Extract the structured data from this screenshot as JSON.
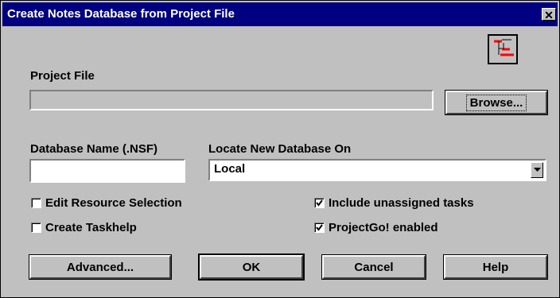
{
  "window": {
    "title": "Create Notes Database from Project File",
    "close_glyph": "✕"
  },
  "project_file": {
    "label": "Project File",
    "value": "",
    "browse_label": "Browse..."
  },
  "database_name": {
    "label": "Database Name (.NSF)",
    "value": ""
  },
  "locate": {
    "label": "Locate New Database On",
    "selected": "Local"
  },
  "checkboxes": {
    "edit_resource": {
      "label": "Edit Resource Selection",
      "checked": false
    },
    "create_taskhelp": {
      "label": "Create Taskhelp",
      "checked": false
    },
    "include_unassigned": {
      "label": "Include unassigned tasks",
      "checked": true
    },
    "projectgo": {
      "label": "ProjectGo! enabled",
      "checked": true
    }
  },
  "buttons": {
    "advanced": "Advanced...",
    "ok": "OK",
    "cancel": "Cancel",
    "help": "Help"
  },
  "icons": {
    "app": "gantt-chart-icon"
  },
  "colors": {
    "titlebar": "#000080",
    "face": "#c0c0c0",
    "icon_red": "#ff0000"
  }
}
